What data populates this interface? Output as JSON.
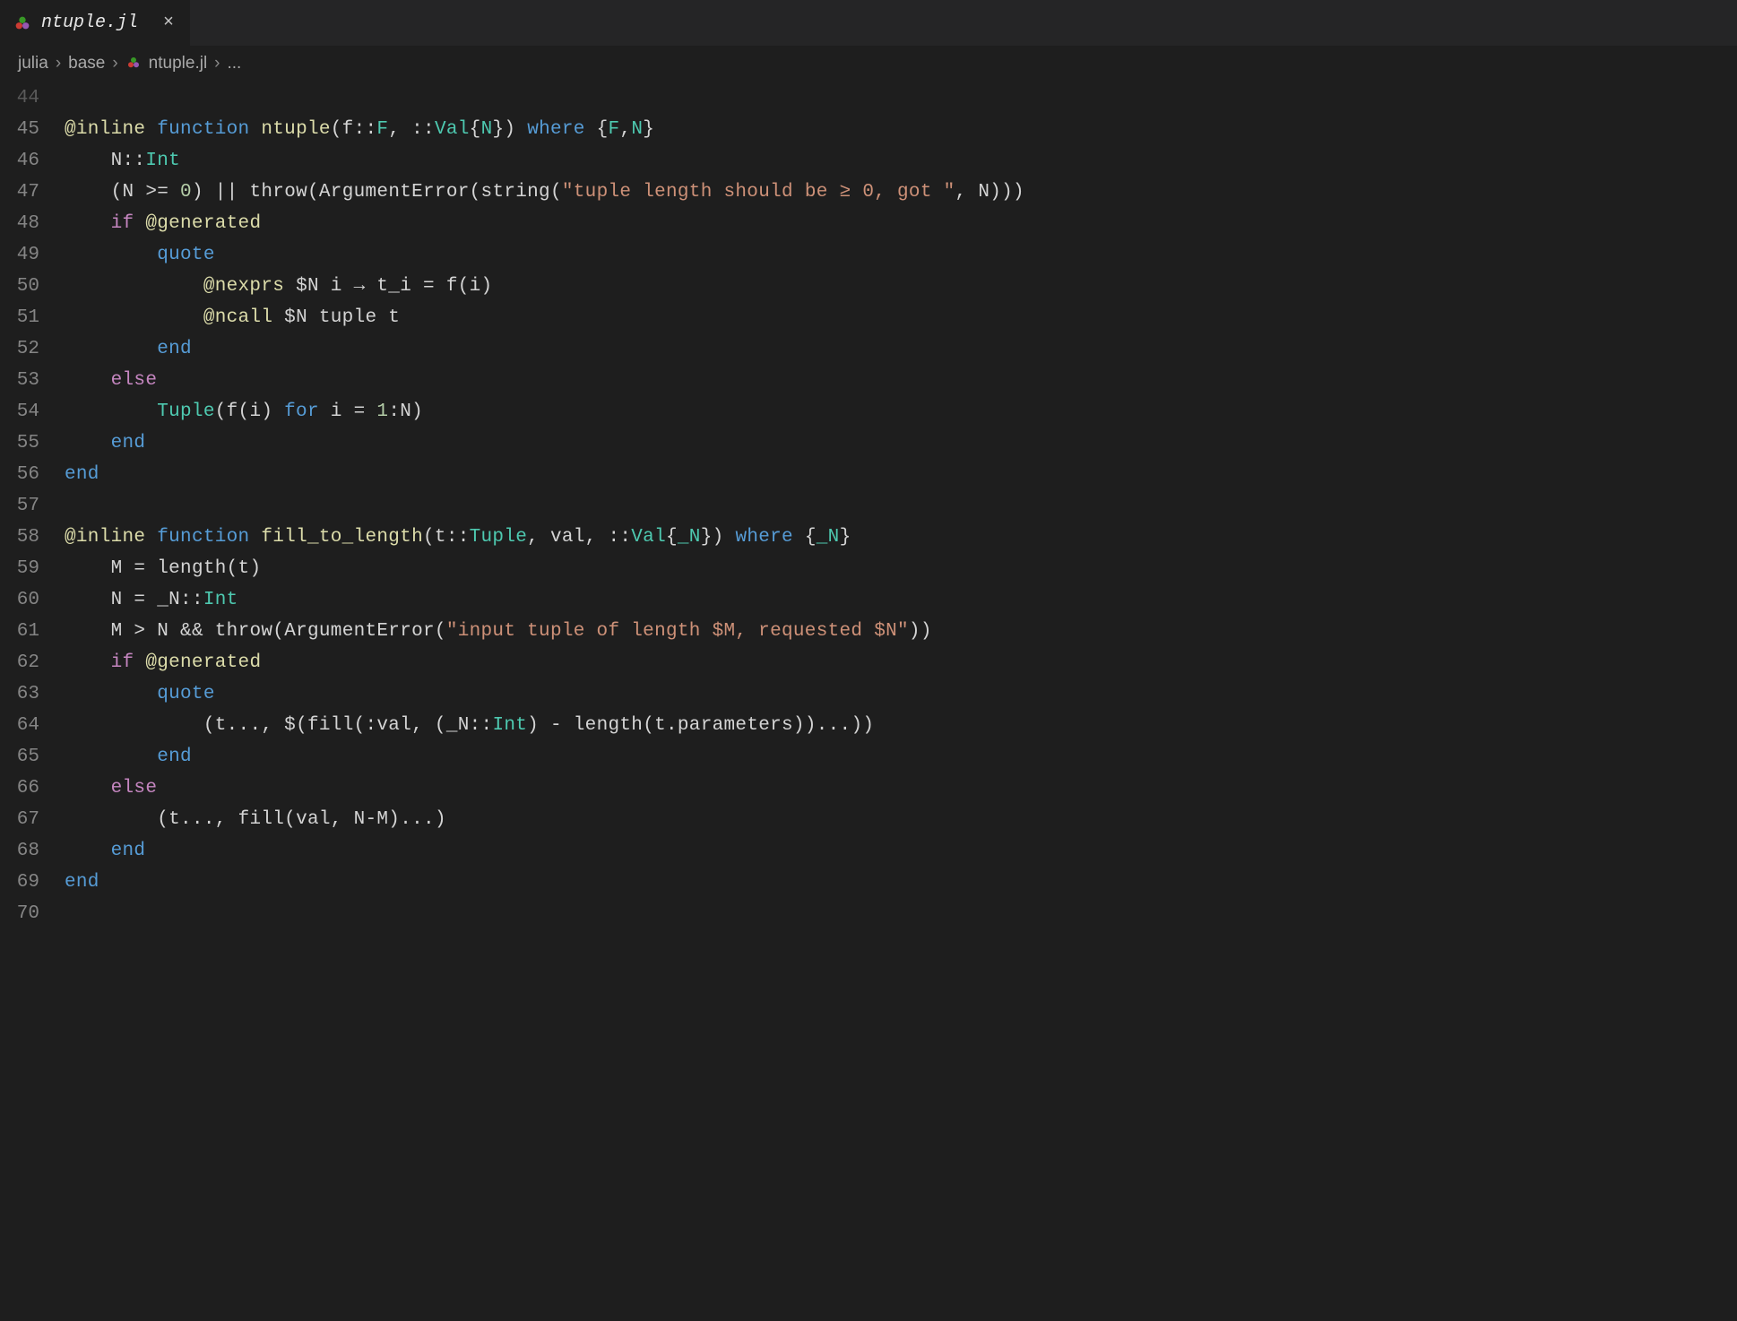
{
  "tab": {
    "filename": "ntuple.jl",
    "close_glyph": "×"
  },
  "breadcrumbs": {
    "items": [
      "julia",
      "base",
      "ntuple.jl",
      "..."
    ],
    "separator": "›"
  },
  "editor": {
    "lines": [
      {
        "num": "44",
        "faded": true,
        "tokens": []
      },
      {
        "num": "45",
        "tokens": [
          {
            "cls": "tk-macro",
            "t": "@inline"
          },
          {
            "cls": "tk-default",
            "t": " "
          },
          {
            "cls": "tk-keyword",
            "t": "function"
          },
          {
            "cls": "tk-default",
            "t": " "
          },
          {
            "cls": "tk-funcdef",
            "t": "ntuple"
          },
          {
            "cls": "tk-default",
            "t": "(f"
          },
          {
            "cls": "tk-op",
            "t": "::"
          },
          {
            "cls": "tk-type",
            "t": "F"
          },
          {
            "cls": "tk-default",
            "t": ", "
          },
          {
            "cls": "tk-op",
            "t": "::"
          },
          {
            "cls": "tk-type",
            "t": "Val"
          },
          {
            "cls": "tk-default",
            "t": "{"
          },
          {
            "cls": "tk-type",
            "t": "N"
          },
          {
            "cls": "tk-default",
            "t": "}) "
          },
          {
            "cls": "tk-keyword",
            "t": "where"
          },
          {
            "cls": "tk-default",
            "t": " {"
          },
          {
            "cls": "tk-type",
            "t": "F"
          },
          {
            "cls": "tk-default",
            "t": ","
          },
          {
            "cls": "tk-type",
            "t": "N"
          },
          {
            "cls": "tk-default",
            "t": "}"
          }
        ]
      },
      {
        "num": "46",
        "indent": 1,
        "tokens": [
          {
            "cls": "tk-default",
            "t": "    N"
          },
          {
            "cls": "tk-op",
            "t": "::"
          },
          {
            "cls": "tk-type",
            "t": "Int"
          }
        ]
      },
      {
        "num": "47",
        "indent": 1,
        "tokens": [
          {
            "cls": "tk-default",
            "t": "    (N "
          },
          {
            "cls": "tk-op",
            "t": ">="
          },
          {
            "cls": "tk-default",
            "t": " "
          },
          {
            "cls": "tk-number",
            "t": "0"
          },
          {
            "cls": "tk-default",
            "t": ") "
          },
          {
            "cls": "tk-op",
            "t": "||"
          },
          {
            "cls": "tk-default",
            "t": " "
          },
          {
            "cls": "tk-call",
            "t": "throw"
          },
          {
            "cls": "tk-default",
            "t": "("
          },
          {
            "cls": "tk-call",
            "t": "ArgumentError"
          },
          {
            "cls": "tk-default",
            "t": "("
          },
          {
            "cls": "tk-call",
            "t": "string"
          },
          {
            "cls": "tk-default",
            "t": "("
          },
          {
            "cls": "tk-string",
            "t": "\"tuple length should be ≥ 0, got \""
          },
          {
            "cls": "tk-default",
            "t": ", N)))"
          }
        ]
      },
      {
        "num": "48",
        "indent": 1,
        "tokens": [
          {
            "cls": "tk-default",
            "t": "    "
          },
          {
            "cls": "tk-ctrl",
            "t": "if"
          },
          {
            "cls": "tk-default",
            "t": " "
          },
          {
            "cls": "tk-macro",
            "t": "@generated"
          }
        ]
      },
      {
        "num": "49",
        "indent": 2,
        "tokens": [
          {
            "cls": "tk-default",
            "t": "        "
          },
          {
            "cls": "tk-keyword",
            "t": "quote"
          }
        ]
      },
      {
        "num": "50",
        "indent": 3,
        "tokens": [
          {
            "cls": "tk-default",
            "t": "            "
          },
          {
            "cls": "tk-macro",
            "t": "@nexprs"
          },
          {
            "cls": "tk-default",
            "t": " "
          },
          {
            "cls": "tk-op",
            "t": "$"
          },
          {
            "cls": "tk-default",
            "t": "N i "
          },
          {
            "cls": "tk-op",
            "t": "→"
          },
          {
            "cls": "tk-default",
            "t": " t_i "
          },
          {
            "cls": "tk-op",
            "t": "="
          },
          {
            "cls": "tk-default",
            "t": " "
          },
          {
            "cls": "tk-call",
            "t": "f"
          },
          {
            "cls": "tk-default",
            "t": "(i)"
          }
        ]
      },
      {
        "num": "51",
        "indent": 3,
        "tokens": [
          {
            "cls": "tk-default",
            "t": "            "
          },
          {
            "cls": "tk-macro",
            "t": "@ncall"
          },
          {
            "cls": "tk-default",
            "t": " "
          },
          {
            "cls": "tk-op",
            "t": "$"
          },
          {
            "cls": "tk-default",
            "t": "N tuple t"
          }
        ]
      },
      {
        "num": "52",
        "indent": 2,
        "tokens": [
          {
            "cls": "tk-default",
            "t": "        "
          },
          {
            "cls": "tk-keyword",
            "t": "end"
          }
        ]
      },
      {
        "num": "53",
        "indent": 1,
        "tokens": [
          {
            "cls": "tk-default",
            "t": "    "
          },
          {
            "cls": "tk-ctrl",
            "t": "else"
          }
        ]
      },
      {
        "num": "54",
        "indent": 2,
        "tokens": [
          {
            "cls": "tk-default",
            "t": "        "
          },
          {
            "cls": "tk-type",
            "t": "Tuple"
          },
          {
            "cls": "tk-default",
            "t": "("
          },
          {
            "cls": "tk-call",
            "t": "f"
          },
          {
            "cls": "tk-default",
            "t": "(i) "
          },
          {
            "cls": "tk-keyword",
            "t": "for"
          },
          {
            "cls": "tk-default",
            "t": " i "
          },
          {
            "cls": "tk-op",
            "t": "="
          },
          {
            "cls": "tk-default",
            "t": " "
          },
          {
            "cls": "tk-number",
            "t": "1"
          },
          {
            "cls": "tk-op",
            "t": ":"
          },
          {
            "cls": "tk-default",
            "t": "N)"
          }
        ]
      },
      {
        "num": "55",
        "indent": 1,
        "tokens": [
          {
            "cls": "tk-default",
            "t": "    "
          },
          {
            "cls": "tk-keyword",
            "t": "end"
          }
        ]
      },
      {
        "num": "56",
        "tokens": [
          {
            "cls": "tk-keyword",
            "t": "end"
          }
        ]
      },
      {
        "num": "57",
        "tokens": []
      },
      {
        "num": "58",
        "tokens": [
          {
            "cls": "tk-macro",
            "t": "@inline"
          },
          {
            "cls": "tk-default",
            "t": " "
          },
          {
            "cls": "tk-keyword",
            "t": "function"
          },
          {
            "cls": "tk-default",
            "t": " "
          },
          {
            "cls": "tk-funcdef",
            "t": "fill_to_length"
          },
          {
            "cls": "tk-default",
            "t": "(t"
          },
          {
            "cls": "tk-op",
            "t": "::"
          },
          {
            "cls": "tk-type",
            "t": "Tuple"
          },
          {
            "cls": "tk-default",
            "t": ", val, "
          },
          {
            "cls": "tk-op",
            "t": "::"
          },
          {
            "cls": "tk-type",
            "t": "Val"
          },
          {
            "cls": "tk-default",
            "t": "{"
          },
          {
            "cls": "tk-type",
            "t": "_N"
          },
          {
            "cls": "tk-default",
            "t": "}) "
          },
          {
            "cls": "tk-keyword",
            "t": "where"
          },
          {
            "cls": "tk-default",
            "t": " {"
          },
          {
            "cls": "tk-type",
            "t": "_N"
          },
          {
            "cls": "tk-default",
            "t": "}"
          }
        ]
      },
      {
        "num": "59",
        "indent": 1,
        "tokens": [
          {
            "cls": "tk-default",
            "t": "    M "
          },
          {
            "cls": "tk-op",
            "t": "="
          },
          {
            "cls": "tk-default",
            "t": " "
          },
          {
            "cls": "tk-call",
            "t": "length"
          },
          {
            "cls": "tk-default",
            "t": "(t)"
          }
        ]
      },
      {
        "num": "60",
        "indent": 1,
        "tokens": [
          {
            "cls": "tk-default",
            "t": "    N "
          },
          {
            "cls": "tk-op",
            "t": "="
          },
          {
            "cls": "tk-default",
            "t": " _N"
          },
          {
            "cls": "tk-op",
            "t": "::"
          },
          {
            "cls": "tk-type",
            "t": "Int"
          }
        ]
      },
      {
        "num": "61",
        "indent": 1,
        "tokens": [
          {
            "cls": "tk-default",
            "t": "    M "
          },
          {
            "cls": "tk-op",
            "t": ">"
          },
          {
            "cls": "tk-default",
            "t": " N "
          },
          {
            "cls": "tk-op",
            "t": "&&"
          },
          {
            "cls": "tk-default",
            "t": " "
          },
          {
            "cls": "tk-call",
            "t": "throw"
          },
          {
            "cls": "tk-default",
            "t": "("
          },
          {
            "cls": "tk-call",
            "t": "ArgumentError"
          },
          {
            "cls": "tk-default",
            "t": "("
          },
          {
            "cls": "tk-string",
            "t": "\"input tuple of length $M, requested $N\""
          },
          {
            "cls": "tk-default",
            "t": "))"
          }
        ]
      },
      {
        "num": "62",
        "indent": 1,
        "tokens": [
          {
            "cls": "tk-default",
            "t": "    "
          },
          {
            "cls": "tk-ctrl",
            "t": "if"
          },
          {
            "cls": "tk-default",
            "t": " "
          },
          {
            "cls": "tk-macro",
            "t": "@generated"
          }
        ]
      },
      {
        "num": "63",
        "indent": 2,
        "tokens": [
          {
            "cls": "tk-default",
            "t": "        "
          },
          {
            "cls": "tk-keyword",
            "t": "quote"
          }
        ]
      },
      {
        "num": "64",
        "indent": 3,
        "tokens": [
          {
            "cls": "tk-default",
            "t": "            (t"
          },
          {
            "cls": "tk-op",
            "t": "..."
          },
          {
            "cls": "tk-default",
            "t": ", "
          },
          {
            "cls": "tk-op",
            "t": "$"
          },
          {
            "cls": "tk-default",
            "t": "("
          },
          {
            "cls": "tk-call",
            "t": "fill"
          },
          {
            "cls": "tk-default",
            "t": "("
          },
          {
            "cls": "tk-op",
            "t": ":"
          },
          {
            "cls": "tk-default",
            "t": "val, (_N"
          },
          {
            "cls": "tk-op",
            "t": "::"
          },
          {
            "cls": "tk-type",
            "t": "Int"
          },
          {
            "cls": "tk-default",
            "t": ") "
          },
          {
            "cls": "tk-op",
            "t": "-"
          },
          {
            "cls": "tk-default",
            "t": " "
          },
          {
            "cls": "tk-call",
            "t": "length"
          },
          {
            "cls": "tk-default",
            "t": "(t.parameters))"
          },
          {
            "cls": "tk-op",
            "t": "..."
          },
          {
            "cls": "tk-default",
            "t": "))"
          }
        ]
      },
      {
        "num": "65",
        "indent": 2,
        "tokens": [
          {
            "cls": "tk-default",
            "t": "        "
          },
          {
            "cls": "tk-keyword",
            "t": "end"
          }
        ]
      },
      {
        "num": "66",
        "indent": 1,
        "tokens": [
          {
            "cls": "tk-default",
            "t": "    "
          },
          {
            "cls": "tk-ctrl",
            "t": "else"
          }
        ]
      },
      {
        "num": "67",
        "indent": 2,
        "tokens": [
          {
            "cls": "tk-default",
            "t": "        (t"
          },
          {
            "cls": "tk-op",
            "t": "..."
          },
          {
            "cls": "tk-default",
            "t": ", "
          },
          {
            "cls": "tk-call",
            "t": "fill"
          },
          {
            "cls": "tk-default",
            "t": "(val, N"
          },
          {
            "cls": "tk-op",
            "t": "-"
          },
          {
            "cls": "tk-default",
            "t": "M)"
          },
          {
            "cls": "tk-op",
            "t": "..."
          },
          {
            "cls": "tk-default",
            "t": ")"
          }
        ]
      },
      {
        "num": "68",
        "indent": 1,
        "tokens": [
          {
            "cls": "tk-default",
            "t": "    "
          },
          {
            "cls": "tk-keyword",
            "t": "end"
          }
        ]
      },
      {
        "num": "69",
        "tokens": [
          {
            "cls": "tk-keyword",
            "t": "end"
          }
        ]
      },
      {
        "num": "70",
        "tokens": []
      }
    ]
  }
}
